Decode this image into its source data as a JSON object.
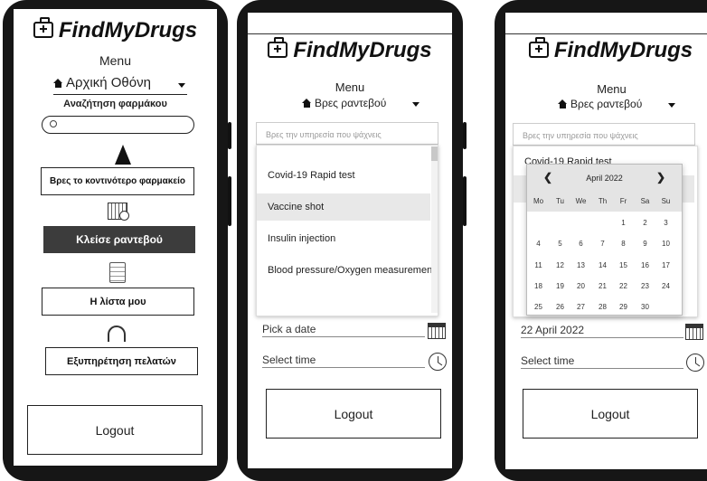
{
  "app": {
    "brand": "FindMyDrugs",
    "menu_label": "Menu"
  },
  "screen1": {
    "menu_value": "Αρχική Οθόνη",
    "search_title": "Αναζήτηση φαρμάκου",
    "search_placeholder": "",
    "nearest_pharmacy": "Βρες το κοντινότερο φαρμακείο",
    "book_appointment": "Κλείσε ραντεβού",
    "my_list": "Η λίστα μου",
    "customer_service": "Εξυπηρέτηση πελατών",
    "logout": "Logout"
  },
  "screen2": {
    "menu_value": "Βρες ραντεβού",
    "search_placeholder": "Βρες την υπηρεσία που ψάχνεις",
    "services": [
      "Covid-19 Rapid test",
      "Vaccine shot",
      "Insulin injection",
      "Blood pressure/Oxygen measurement"
    ],
    "selected_service_index": 1,
    "date_placeholder": "Pick a date",
    "time_placeholder": "Select time",
    "logout": "Logout"
  },
  "screen3": {
    "menu_value": "Βρες ραντεβού",
    "search_placeholder": "Βρες την υπηρεσία που ψάχνεις",
    "behind_item": "Covid-19 Rapid test",
    "calendar": {
      "month_label": "April 2022",
      "prev": "❮",
      "next": "❯",
      "weekdays": [
        "Mo",
        "Tu",
        "We",
        "Th",
        "Fr",
        "Sa",
        "Su"
      ],
      "first_weekday_index": 4,
      "days_in_month": 30
    },
    "date_value": "22 April 2022",
    "time_placeholder": "Select time",
    "logout": "Logout"
  }
}
